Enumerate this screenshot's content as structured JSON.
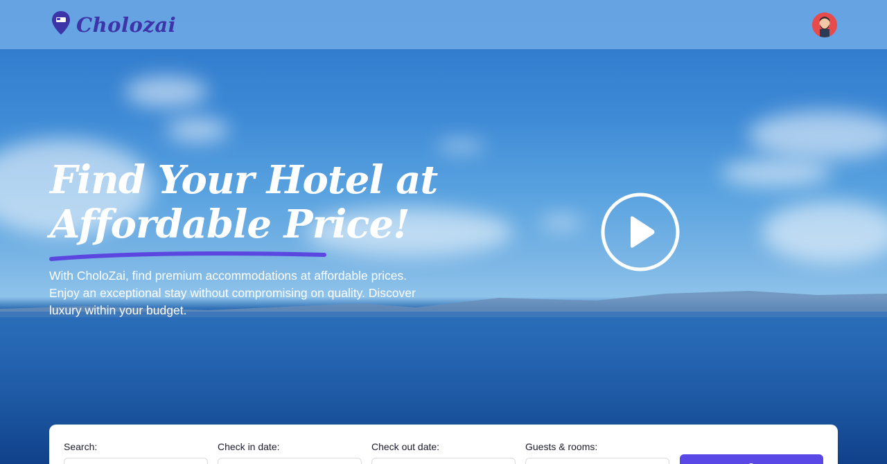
{
  "brand": {
    "name": "Cholozai"
  },
  "hero": {
    "headline_line1": "Find Your Hotel at",
    "headline_line2": "Affordable Price!",
    "description": "With CholoZai, find premium accommodations at affordable prices. Enjoy an exceptional stay without compromising on quality. Discover luxury within your budget."
  },
  "search_form": {
    "search_label": "Search:",
    "checkin_label": "Check in date:",
    "checkout_label": "Check out date:",
    "guests_label": "Guests & rooms:"
  },
  "colors": {
    "accent": "#5948e5",
    "brand": "#3d34a8",
    "underline": "#5b46e0"
  },
  "icons": {
    "logo": "map-pin-hotel-icon",
    "play": "play-icon",
    "avatar": "user-avatar",
    "calendar": "calendar-icon",
    "search": "search-icon"
  }
}
